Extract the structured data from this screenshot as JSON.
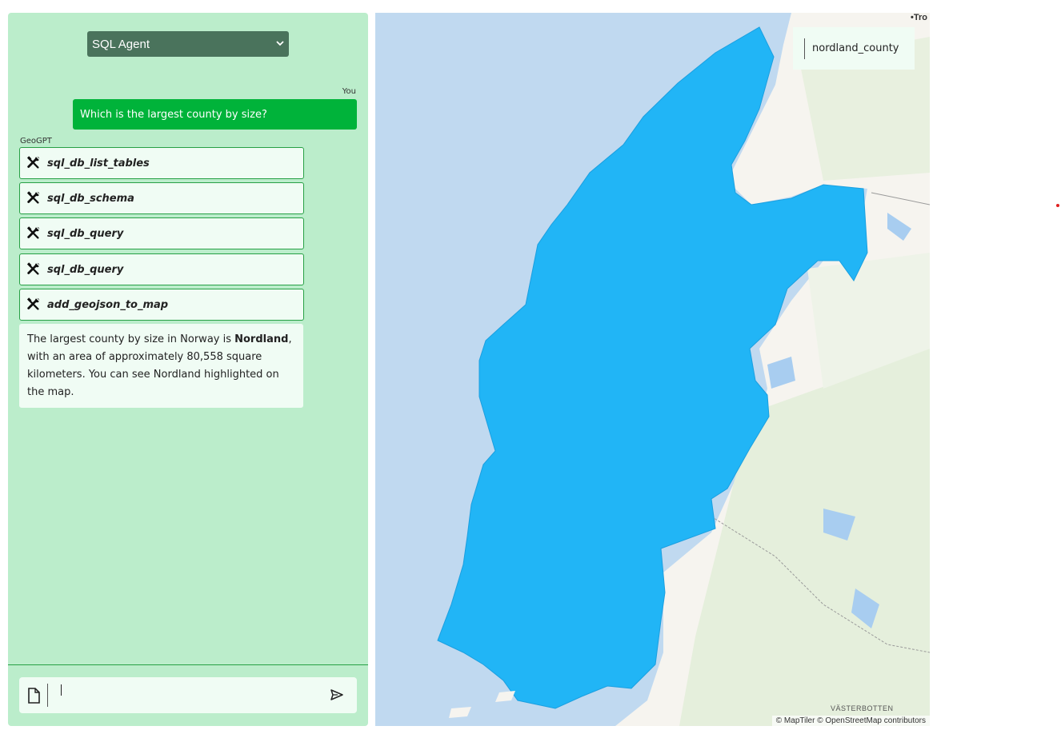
{
  "agent_select": {
    "value": "SQL Agent"
  },
  "chat": {
    "user_label": "You",
    "user_message": "Which is the largest county by size?",
    "bot_label": "GeoGPT",
    "tool_calls": [
      {
        "label": "sql_db_list_tables",
        "icon": "tools-icon"
      },
      {
        "label": "sql_db_schema",
        "icon": "tools-icon"
      },
      {
        "label": "sql_db_query",
        "icon": "tools-icon"
      },
      {
        "label": "sql_db_query",
        "icon": "tools-icon"
      },
      {
        "label": "add_geojson_to_map",
        "icon": "tools-icon"
      }
    ],
    "answer": {
      "prefix": "The largest county by size in Norway is ",
      "bold": "Nordland",
      "suffix": ", with an area of approximately 80,558 square kilometers. You can see Nordland highlighted on the map."
    }
  },
  "input": {
    "value": "",
    "attach_icon": "file-icon",
    "send_icon": "send-icon"
  },
  "map": {
    "layer_name": "nordland_county",
    "city_label": "•Tro",
    "region_label": "VÄSTERBOTTEN",
    "attribution": "© MapTiler © OpenStreetMap contributors",
    "colors": {
      "sea": "#c0d9f0",
      "land": "#f6f4ef",
      "forest": "#e3eed9",
      "highlight": "#21b5f6",
      "highlight_stroke": "#1a9fe0"
    }
  },
  "colors": {
    "panel_bg": "#bbedcb",
    "user_bubble": "#00b33a",
    "tool_border": "#27a045",
    "select_bg": "#4a735c"
  }
}
